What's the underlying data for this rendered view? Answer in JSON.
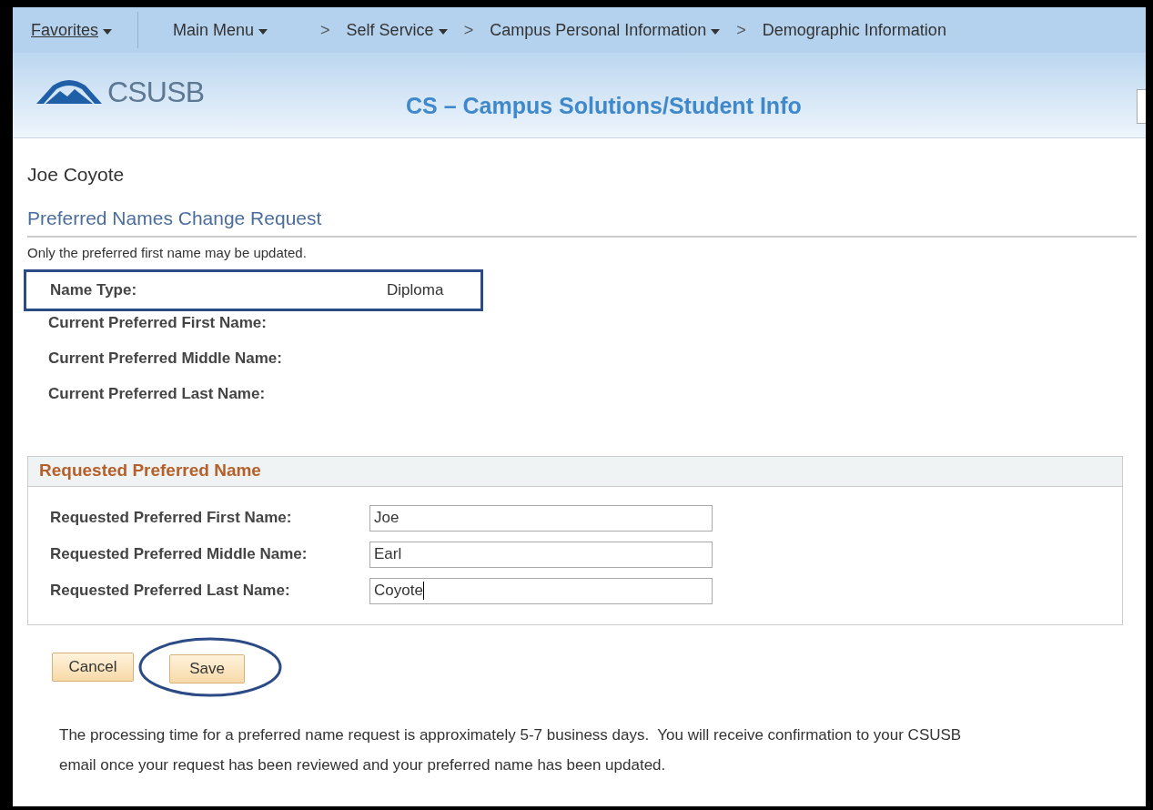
{
  "breadcrumbs": [
    {
      "label": "Favorites",
      "dropdown": true,
      "kind": "favorites"
    },
    {
      "label": "Main Menu",
      "dropdown": true,
      "kind": "crumb"
    },
    {
      "label": "Self Service",
      "dropdown": true,
      "kind": "crumb"
    },
    {
      "label": "Campus Personal Information",
      "dropdown": true,
      "kind": "crumb"
    },
    {
      "label": "Demographic Information",
      "dropdown": false,
      "kind": "crumb"
    }
  ],
  "separator": ">",
  "header": {
    "logo_text": "CSUSB",
    "title": "CS – Campus Solutions/Student Info"
  },
  "person_name": "Joe Coyote",
  "page_title": "Preferred Names Change Request",
  "instruction": "Only the preferred first name may be updated.",
  "info_rows": [
    {
      "label": "Name Type:",
      "value": "Diploma",
      "highlighted": true
    },
    {
      "label": "Current Preferred First Name:",
      "highlighted": false
    },
    {
      "label": "Current Preferred Middle Name:",
      "highlighted": false
    },
    {
      "label": "Current Preferred Last Name:",
      "highlighted": false
    }
  ],
  "group": {
    "title": "Requested Preferred Name",
    "fields": [
      {
        "label": "Requested Preferred First Name:",
        "value": "Joe",
        "focused": false
      },
      {
        "label": "Requested Preferred Middle Name:",
        "value": "Earl",
        "focused": false
      },
      {
        "label": "Requested Preferred Last Name:",
        "value": "Coyote",
        "focused": true
      }
    ]
  },
  "buttons": [
    {
      "label": "Cancel",
      "highlighted": false
    },
    {
      "label": "Save",
      "highlighted": true
    }
  ],
  "note_lines": [
    "The processing time for a preferred name request is approximately 5-7 business days.  You will receive confirmation to your CSUSB",
    "email once your request has been reviewed and your preferred name has been updated."
  ]
}
